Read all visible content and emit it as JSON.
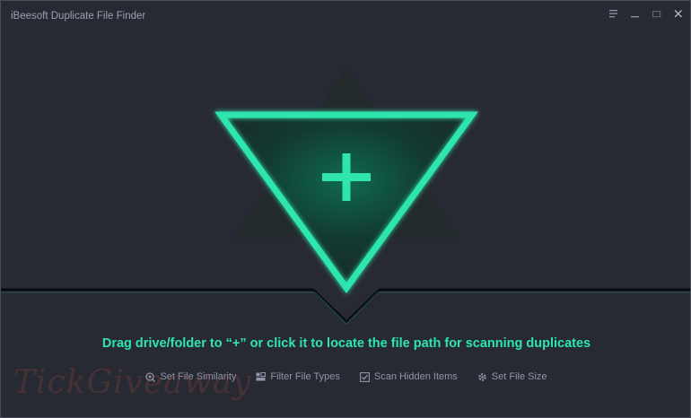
{
  "window": {
    "title": "iBeesoft Duplicate File Finder",
    "controls": [
      {
        "name": "menu",
        "icon": "menu-icon"
      },
      {
        "name": "minimize",
        "icon": "minimize-icon"
      },
      {
        "name": "maximize",
        "icon": "maximize-icon"
      },
      {
        "name": "close",
        "icon": "close-icon"
      }
    ]
  },
  "main": {
    "add_icon": "plus-icon",
    "instruction": "Drag drive/folder to “+” or click it to locate the file path for scanning duplicates",
    "options": [
      {
        "label": "Set File Similarity",
        "icon": "similarity-icon"
      },
      {
        "label": "Filter File Types",
        "icon": "file-types-icon"
      },
      {
        "label": "Scan Hidden Items",
        "icon": "checkbox-icon"
      },
      {
        "label": "Set File Size",
        "icon": "gear-icon"
      }
    ]
  },
  "watermark": "TickGiveaway",
  "colors": {
    "accent": "#2ee6ad",
    "background": "#282a33",
    "muted_text": "#8f95a8"
  }
}
